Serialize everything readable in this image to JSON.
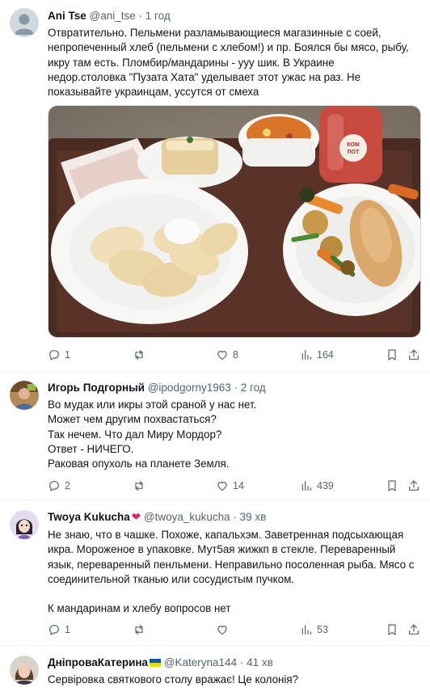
{
  "posts": [
    {
      "name": "Ani Tse",
      "handle": "@ani_tse",
      "time": "· 1 год",
      "lines": [
        "Отвратительно. Пельмени разламывающиеся магазинные с соей,",
        "непропеченный хлеб (пельмени с хлебом!) и пр. Боялся бы мясо, рыбу,",
        "икру там есть. Пломбир/мандарины - ууу шик. В Украине",
        "недор.столовка \"Пузата Хата\" уделывает этот ужас на раз. Не",
        "показывайте украинцам, уссутся от смеха"
      ],
      "media_label": "КОМ ПОТ",
      "replies": "1",
      "reposts": "",
      "likes": "8",
      "views": "164"
    },
    {
      "name": "Игорь Подгорный",
      "handle": "@ipodgorny1963",
      "time": "· 2 год",
      "lines": [
        "Во мудак или икры этой сраной у нас нет.",
        "Может чем другим похвастаться?",
        "Так нечем. Что дал Миру Мордор?",
        "Ответ - НИЧЕГО.",
        "Раковая опухоль на планете Земля."
      ],
      "replies": "2",
      "reposts": "",
      "likes": "14",
      "views": "439"
    },
    {
      "name": "Twoya Kukucha",
      "name_suffix": "❤",
      "handle": "@twoya_kukucha",
      "time": "· 39 хв",
      "lines": [
        "Не знаю, что в чашке. Похоже, капальхэм. Заветренная подсыхающая",
        "икра. Мороженое в упаковке. Мут5ая жижкп в стекле. Переваренный",
        "язык, переваренный пенльмени. Неправильно посоленная рыба. Мясо с",
        "соединительной тканью или сосудистым пучком.",
        "",
        "К мандаринам и хлебу вопросов нет"
      ],
      "replies": "1",
      "reposts": "",
      "likes": "",
      "views": "53"
    },
    {
      "name": "ДніпроваКатерина",
      "handle": "@Kateryna144",
      "time": "· 41 хв",
      "lines": [
        "Сервіровка святкового столу вражає! Це колонія?"
      ]
    }
  ],
  "colors": {
    "text": "#0f1419",
    "secondary": "#536471",
    "divider": "#eff3f4",
    "heart": "#e0245e",
    "flag_blue": "#0057b7",
    "flag_yellow": "#ffd700"
  },
  "icons": [
    "reply-icon",
    "repost-icon",
    "like-icon",
    "views-icon",
    "bookmark-icon",
    "share-icon"
  ]
}
